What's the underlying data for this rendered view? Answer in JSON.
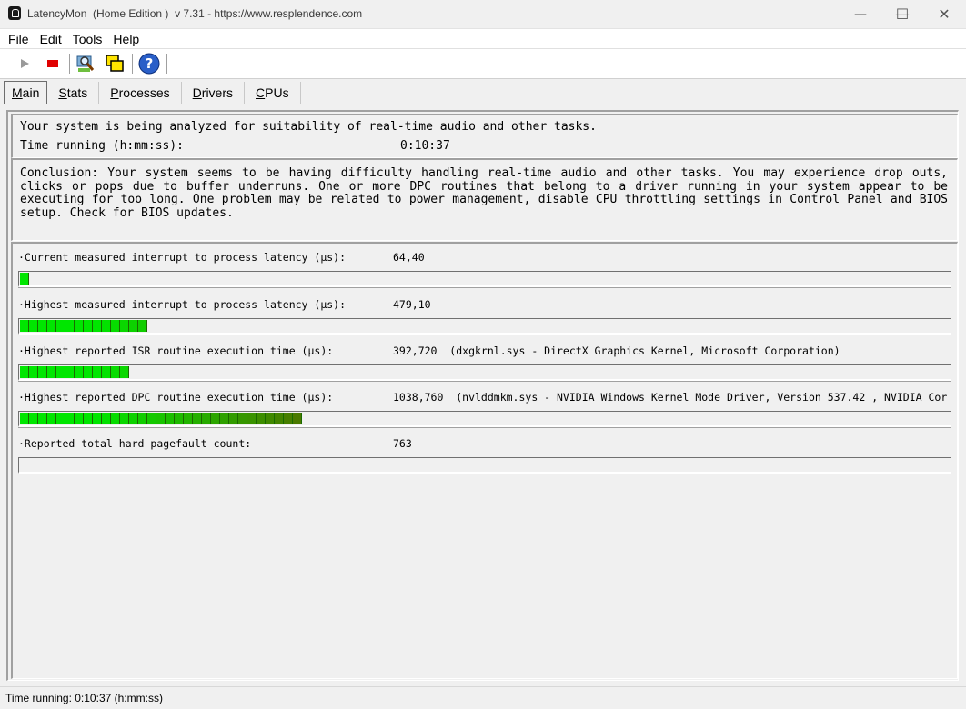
{
  "window": {
    "title": "LatencyMon  (Home Edition )  v 7.31 - https://www.resplendence.com",
    "minimize_glyph": "—",
    "maximize_glyph": "☐",
    "close_glyph": "✕"
  },
  "menu": [
    {
      "key": "F",
      "rest": "ile"
    },
    {
      "key": "E",
      "rest": "dit"
    },
    {
      "key": "T",
      "rest": "ools"
    },
    {
      "key": "H",
      "rest": "elp"
    }
  ],
  "toolbar": {
    "icons": [
      "play-icon",
      "stop-icon",
      "monitor-search-icon",
      "windows-overlap-icon",
      "help-icon"
    ]
  },
  "tabs": [
    {
      "key": "M",
      "rest": "ain",
      "active": true
    },
    {
      "key": "S",
      "rest": "tats",
      "active": false
    },
    {
      "key": "P",
      "rest": "rocesses",
      "active": false
    },
    {
      "key": "D",
      "rest": "rivers",
      "active": false
    },
    {
      "key": "C",
      "rest": "PUs",
      "active": false
    }
  ],
  "status": {
    "analysis_text": "Your system is being analyzed for suitability of real-time audio and other tasks.",
    "time_label": "Time running (h:mm:ss):",
    "time_value": "0:10:37"
  },
  "conclusion": "Conclusion: Your system seems to be having difficulty handling real-time audio and other tasks. You may experience drop outs, clicks or pops due to buffer underruns. One or more DPC routines that belong to a driver running in your system appear to be executing for too long. One problem may be related to power management, disable CPU throttling settings in Control Panel and BIOS setup. Check for BIOS updates.",
  "metrics": [
    {
      "label": "·Current measured interrupt to process latency (µs):",
      "value": "64,40",
      "segments_filled": 1
    },
    {
      "label": "·Highest measured interrupt to process latency (µs):",
      "value": "479,10",
      "segments_filled": 14
    },
    {
      "label": "·Highest reported ISR routine execution time (µs):",
      "value": "392,720  (dxgkrnl.sys - DirectX Graphics Kernel, Microsoft Corporation)",
      "segments_filled": 12
    },
    {
      "label": "·Highest reported DPC routine execution time (µs):",
      "value": "1038,760  (nvlddmkm.sys - NVIDIA Windows Kernel Mode Driver, Version 537.42 , NVIDIA Cor",
      "segments_filled": 31
    },
    {
      "label": "·Reported total hard pagefault count:",
      "value": "763",
      "segments_filled": 0
    }
  ],
  "colors": {
    "segment_bright": "#00ff00",
    "segment_dark": "#4a7a00"
  },
  "statusbar": {
    "text": "Time running: 0:10:37  (h:mm:ss)"
  }
}
